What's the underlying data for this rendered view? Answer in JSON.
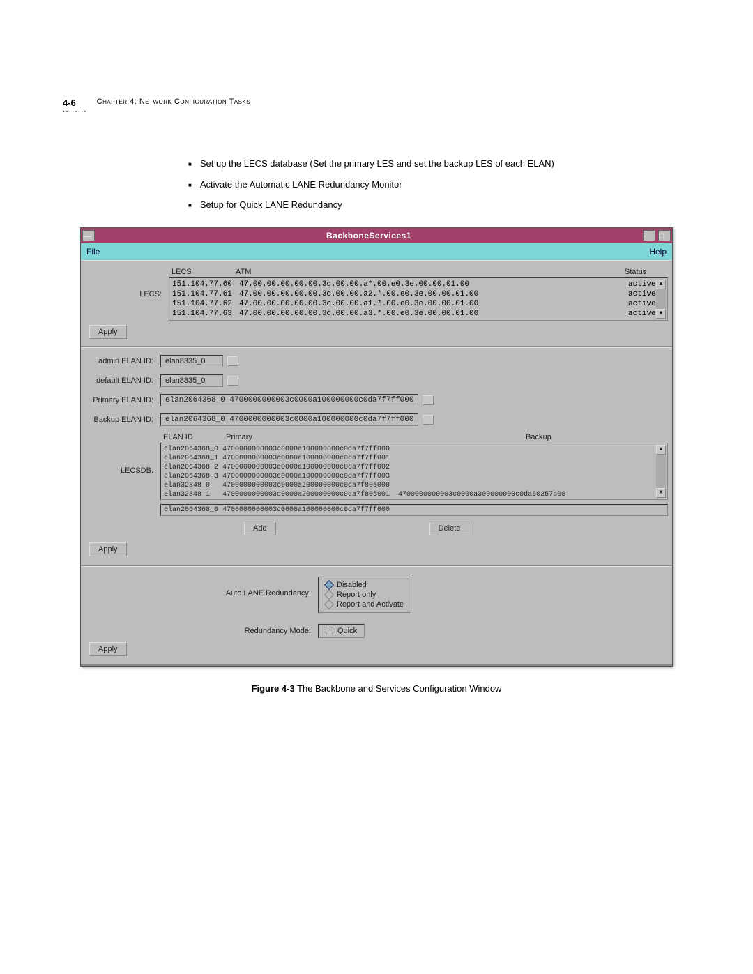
{
  "header": {
    "pgnum": "4-6",
    "chapter": "Chapter 4: Network Configuration Tasks",
    "dots": "········"
  },
  "bullets": {
    "b1": "Set up the LECS database (Set the primary LES and set the backup LES of each ELAN)",
    "b2": "Activate the Automatic LANE Redundancy Monitor",
    "b3": "Setup for Quick LANE Redundancy"
  },
  "win": {
    "title": "BackboneServices1",
    "menu_file": "File",
    "menu_help": "Help"
  },
  "lecs": {
    "label": "LECS:",
    "hdr_lecs": "LECS",
    "hdr_atm": "ATM",
    "hdr_status": "Status",
    "rows": {
      "r0": {
        "ip": "151.104.77.60",
        "atm": "47.00.00.00.00.00.3c.00.00.a*.00.e0.3e.00.00.01.00",
        "st": "active"
      },
      "r1": {
        "ip": "151.104.77.61",
        "atm": "47.00.00.00.00.00.3c.00.00.a2.*.00.e0.3e.00.00.01.00",
        "st": "active"
      },
      "r2": {
        "ip": "151.104.77.62",
        "atm": "47.00.00.00.00.00.3c.00.00.a1.*.00.e0.3e.00.00.01.00",
        "st": "active"
      },
      "r3": {
        "ip": "151.104.77.63",
        "atm": "47.00.00.00.00.00.3c.00.00.a3.*.00.e0.3e.00.00.01.00",
        "st": "active"
      }
    }
  },
  "btn_apply": "Apply",
  "form": {
    "admin_label": "admin ELAN ID:",
    "admin_val": "elan8335_0",
    "default_label": "default ELAN ID:",
    "default_val": "elan8335_0",
    "primary_label": "Primary ELAN ID:",
    "primary_val": "elan2064368_0 4700000000003c0000a100000000c0da7f7ff000",
    "backup_label": "Backup ELAN ID:",
    "backup_val": "elan2064368_0 4700000000003c0000a100000000c0da7f7ff000"
  },
  "lecsdb": {
    "label": "LECSDB:",
    "hdr_id": "ELAN ID",
    "hdr_primary": "Primary",
    "hdr_backup": "Backup",
    "rows": {
      "r0": "elan2064368_0 4700000000003c0000a100000000c0da7f7ff000",
      "r1": "elan2064368_1 4700000000003c0000a100000000c0da7f7ff001",
      "r2": "elan2064368_2 4700000000003c0000a100000000c0da7f7ff002",
      "r3": "elan2064368_3 4700000000003c0000a100000000c0da7f7ff003",
      "r4": "elan32848_0   4700000000003c0000a200000000c0da7f805000",
      "r5": "elan32848_1   4700000000003c0000a200000000c0da7f805001  4700000000003c0000a300000000c0da60257b00"
    },
    "input": "elan2064368_0 4700000000003c0000a100000000c0da7f7ff000",
    "btn_add": "Add",
    "btn_delete": "Delete"
  },
  "redund": {
    "label": "Auto LANE Redundancy:",
    "opt_disabled": "Disabled",
    "opt_report": "Report only",
    "opt_activate": "Report and Activate",
    "mode_label": "Redundancy Mode:",
    "mode_val": "Quick"
  },
  "caption_bold": "Figure 4-3",
  "caption_rest": "   The Backbone and Services Configuration Window"
}
